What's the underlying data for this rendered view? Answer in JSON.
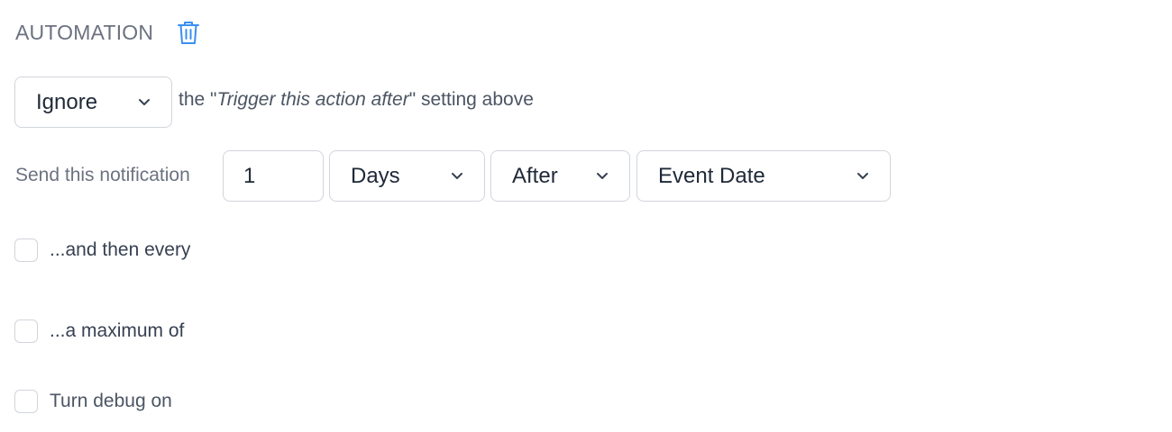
{
  "section": {
    "title": "AUTOMATION",
    "delete_icon": "trash-icon",
    "accent_color": "#3b8ff0"
  },
  "ignore_row": {
    "select_value": "Ignore",
    "text_before": "the \"",
    "text_italic": "Trigger this action after",
    "text_after": "\" setting above"
  },
  "notification_row": {
    "label": "Send this notification",
    "amount_value": "1",
    "unit_value": "Days",
    "relation_value": "After",
    "reference_value": "Event Date"
  },
  "options": {
    "repeat_label": "...and then every",
    "maximum_label": "...a maximum of",
    "debug_label": "Turn debug on"
  }
}
